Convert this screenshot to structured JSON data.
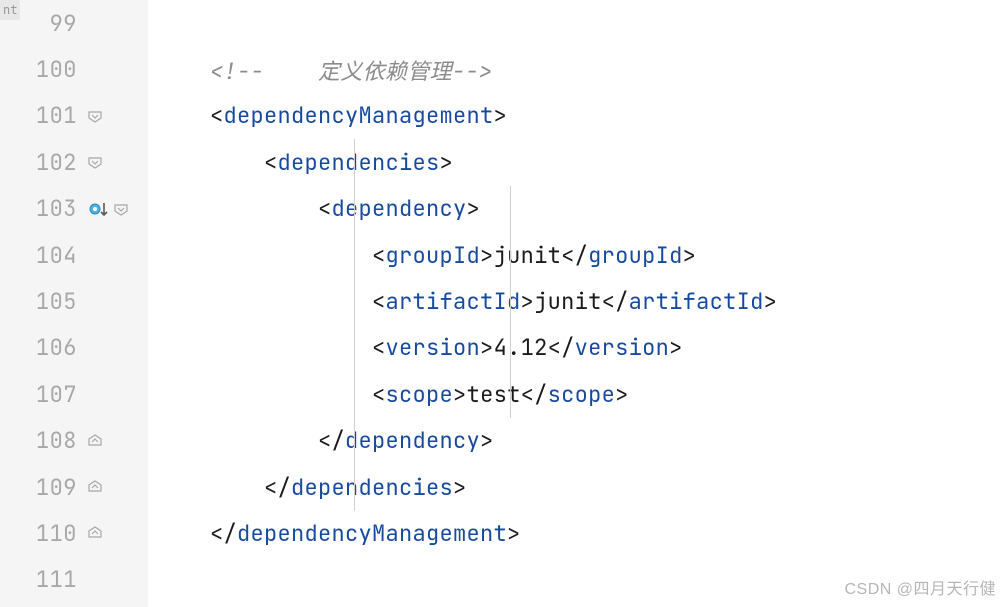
{
  "watermark": "CSDN @四月天行健",
  "nt_label": "nt",
  "lines": [
    {
      "num": "99",
      "fold": null,
      "special": null,
      "tokens": []
    },
    {
      "num": "100",
      "fold": null,
      "special": null,
      "tokens": [
        {
          "t": "indent",
          "v": "    "
        },
        {
          "t": "comment",
          "v": "<!--    定义依赖管理-->"
        }
      ]
    },
    {
      "num": "101",
      "fold": "open",
      "special": null,
      "tokens": [
        {
          "t": "indent",
          "v": "    "
        },
        {
          "t": "bracket",
          "v": "<"
        },
        {
          "t": "tag",
          "v": "dependencyManagement"
        },
        {
          "t": "bracket",
          "v": ">"
        }
      ]
    },
    {
      "num": "102",
      "fold": "open",
      "special": null,
      "tokens": [
        {
          "t": "indent",
          "v": "        "
        },
        {
          "t": "bracket",
          "v": "<"
        },
        {
          "t": "tag",
          "v": "dependencies"
        },
        {
          "t": "bracket",
          "v": ">"
        }
      ]
    },
    {
      "num": "103",
      "fold": "open",
      "special": "reorder",
      "tokens": [
        {
          "t": "indent",
          "v": "            "
        },
        {
          "t": "bracket",
          "v": "<"
        },
        {
          "t": "tag",
          "v": "dependency"
        },
        {
          "t": "bracket",
          "v": ">"
        }
      ]
    },
    {
      "num": "104",
      "fold": null,
      "special": null,
      "tokens": [
        {
          "t": "indent",
          "v": "                "
        },
        {
          "t": "bracket",
          "v": "<"
        },
        {
          "t": "tag",
          "v": "groupId"
        },
        {
          "t": "bracket",
          "v": ">"
        },
        {
          "t": "text",
          "v": "junit"
        },
        {
          "t": "bracket",
          "v": "</"
        },
        {
          "t": "tag",
          "v": "groupId"
        },
        {
          "t": "bracket",
          "v": ">"
        }
      ]
    },
    {
      "num": "105",
      "fold": null,
      "special": null,
      "tokens": [
        {
          "t": "indent",
          "v": "                "
        },
        {
          "t": "bracket",
          "v": "<"
        },
        {
          "t": "tag",
          "v": "artifactId"
        },
        {
          "t": "bracket",
          "v": ">"
        },
        {
          "t": "text",
          "v": "junit"
        },
        {
          "t": "bracket",
          "v": "</"
        },
        {
          "t": "tag",
          "v": "artifactId"
        },
        {
          "t": "bracket",
          "v": ">"
        }
      ]
    },
    {
      "num": "106",
      "fold": null,
      "special": null,
      "tokens": [
        {
          "t": "indent",
          "v": "                "
        },
        {
          "t": "bracket",
          "v": "<"
        },
        {
          "t": "tag",
          "v": "version"
        },
        {
          "t": "bracket",
          "v": ">"
        },
        {
          "t": "text",
          "v": "4.12"
        },
        {
          "t": "bracket",
          "v": "</"
        },
        {
          "t": "tag",
          "v": "version"
        },
        {
          "t": "bracket",
          "v": ">"
        }
      ]
    },
    {
      "num": "107",
      "fold": null,
      "special": null,
      "tokens": [
        {
          "t": "indent",
          "v": "                "
        },
        {
          "t": "bracket",
          "v": "<"
        },
        {
          "t": "tag",
          "v": "scope"
        },
        {
          "t": "bracket",
          "v": ">"
        },
        {
          "t": "text",
          "v": "test"
        },
        {
          "t": "bracket",
          "v": "</"
        },
        {
          "t": "tag",
          "v": "scope"
        },
        {
          "t": "bracket",
          "v": ">"
        }
      ]
    },
    {
      "num": "108",
      "fold": "close",
      "special": null,
      "tokens": [
        {
          "t": "indent",
          "v": "            "
        },
        {
          "t": "bracket",
          "v": "</"
        },
        {
          "t": "tag",
          "v": "dependency"
        },
        {
          "t": "bracket",
          "v": ">"
        }
      ]
    },
    {
      "num": "109",
      "fold": "close",
      "special": null,
      "tokens": [
        {
          "t": "indent",
          "v": "        "
        },
        {
          "t": "bracket",
          "v": "</"
        },
        {
          "t": "tag",
          "v": "dependencies"
        },
        {
          "t": "bracket",
          "v": ">"
        }
      ]
    },
    {
      "num": "110",
      "fold": "close",
      "special": null,
      "tokens": [
        {
          "t": "indent",
          "v": "    "
        },
        {
          "t": "bracket",
          "v": "</"
        },
        {
          "t": "tag",
          "v": "dependencyManagement"
        },
        {
          "t": "bracket",
          "v": ">"
        }
      ]
    },
    {
      "num": "111",
      "fold": null,
      "special": null,
      "tokens": []
    }
  ]
}
